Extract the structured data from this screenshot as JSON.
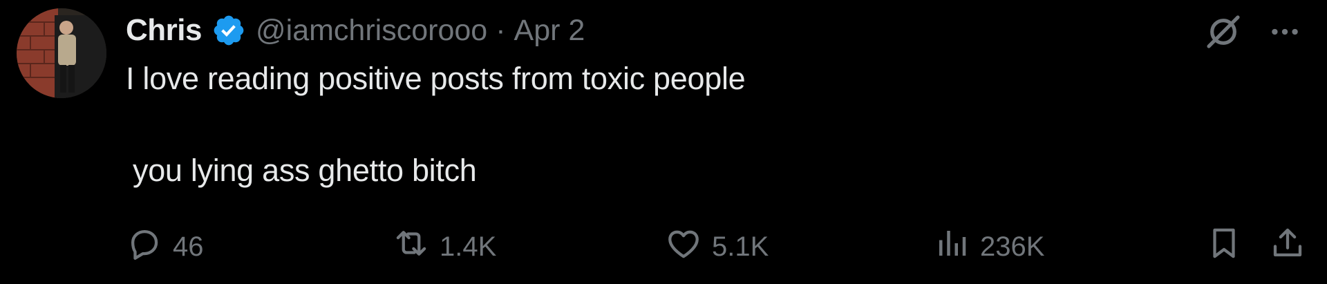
{
  "tweet": {
    "author": {
      "display_name": "Chris",
      "handle": "@iamchriscorooo",
      "verified": true,
      "verified_icon": "verified-badge-icon",
      "avatar": "profile-photo"
    },
    "separator": "·",
    "timestamp": "Apr 2",
    "lines": [
      "I love reading positive posts from toxic people",
      "you lying ass ghetto bitch"
    ],
    "metrics": {
      "replies": "46",
      "reposts": "1.4K",
      "likes": "5.1K",
      "views": "236K"
    },
    "icons": {
      "grok": "grok-icon",
      "more": "more-icon",
      "reply": "reply-icon",
      "repost": "repost-icon",
      "like": "heart-icon",
      "views": "views-icon",
      "bookmark": "bookmark-icon",
      "share": "share-icon"
    },
    "colors": {
      "background": "#000000",
      "text": "#e7e9ea",
      "secondary": "#71767b",
      "verified": "#1d9bf0"
    }
  }
}
